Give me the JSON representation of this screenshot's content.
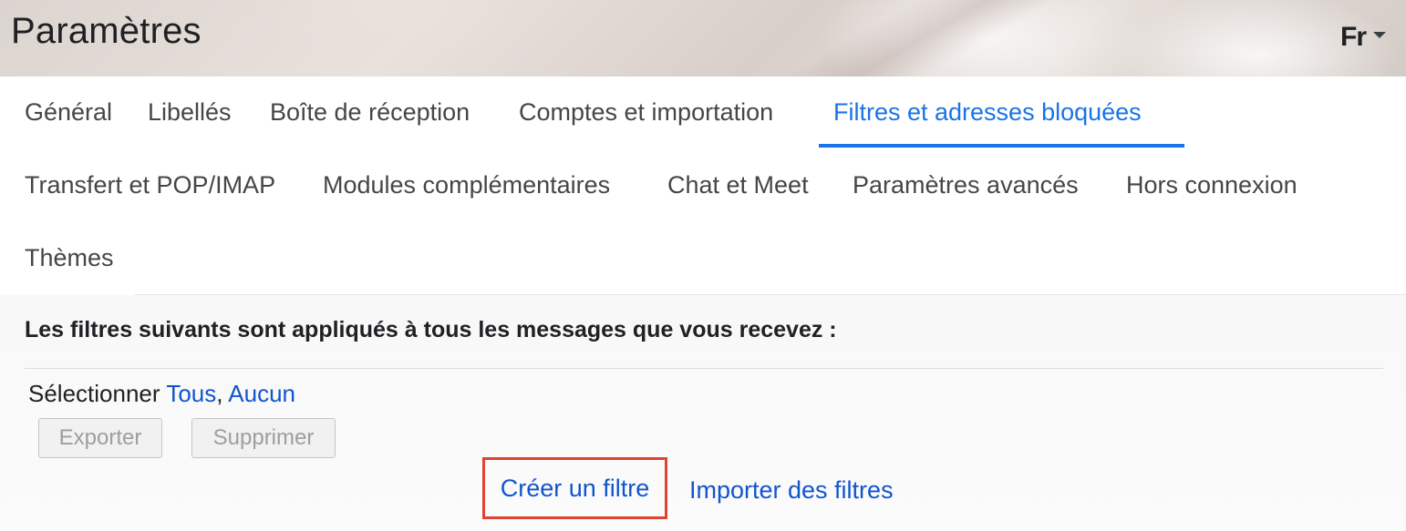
{
  "header": {
    "title": "Paramètres",
    "language": "Fr",
    "language_icon": "chevron-down-icon"
  },
  "tabs": [
    {
      "label": "Général",
      "active": false
    },
    {
      "label": "Libellés",
      "active": false
    },
    {
      "label": "Boîte de réception",
      "active": false
    },
    {
      "label": "Comptes et importation",
      "active": false
    },
    {
      "label": "Filtres et adresses bloquées",
      "active": true
    },
    {
      "label": "Transfert et POP/IMAP",
      "active": false
    },
    {
      "label": "Modules complémentaires",
      "active": false
    },
    {
      "label": "Chat et Meet",
      "active": false
    },
    {
      "label": "Paramètres avancés",
      "active": false
    },
    {
      "label": "Hors connexion",
      "active": false
    },
    {
      "label": "Thèmes",
      "active": false
    }
  ],
  "filters": {
    "heading": "Les filtres suivants sont appliqués à tous les messages que vous recevez :",
    "select_label": "Sélectionner",
    "select_all": "Tous",
    "select_separator": ",",
    "select_none": "Aucun",
    "export_button": "Exporter",
    "delete_button": "Supprimer",
    "create_filter": "Créer un filtre",
    "import_filters": "Importer des filtres"
  },
  "colors": {
    "accent": "#1a73e8",
    "link": "#1155cc",
    "highlight_box": "#e0432f"
  }
}
